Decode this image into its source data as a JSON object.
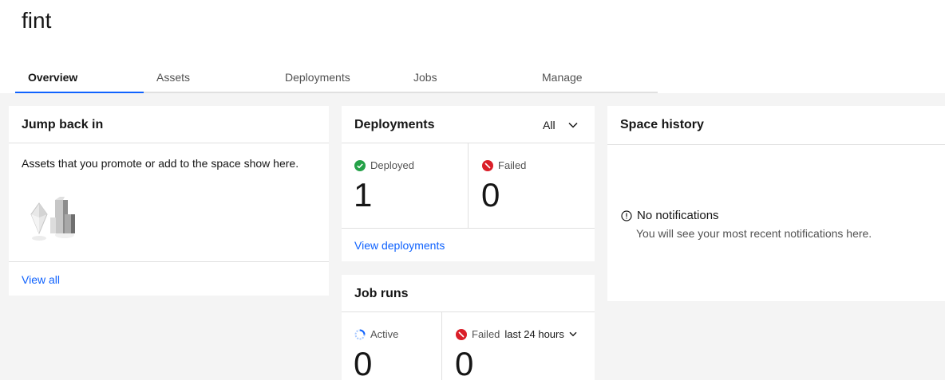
{
  "header": {
    "title": "fint"
  },
  "tabs": [
    {
      "label": "Overview"
    },
    {
      "label": "Assets"
    },
    {
      "label": "Deployments"
    },
    {
      "label": "Jobs"
    },
    {
      "label": "Manage"
    }
  ],
  "jump_back_in": {
    "title": "Jump back in",
    "description": "Assets that you promote or add to the space show here.",
    "view_all": "View all"
  },
  "deployments": {
    "title": "Deployments",
    "filter_value": "All",
    "deployed_label": "Deployed",
    "deployed_count": "1",
    "failed_label": "Failed",
    "failed_count": "0",
    "view_link": "View deployments"
  },
  "job_runs": {
    "title": "Job runs",
    "active_label": "Active",
    "active_count": "0",
    "failed_label": "Failed",
    "failed_period": "last 24 hours",
    "failed_count": "0"
  },
  "space_history": {
    "title": "Space history",
    "empty_title": "No notifications",
    "empty_desc": "You will see your most recent notifications here."
  },
  "colors": {
    "accent": "#0f62fe",
    "success": "#24a148",
    "error": "#da1e28",
    "background": "#f4f4f4"
  }
}
